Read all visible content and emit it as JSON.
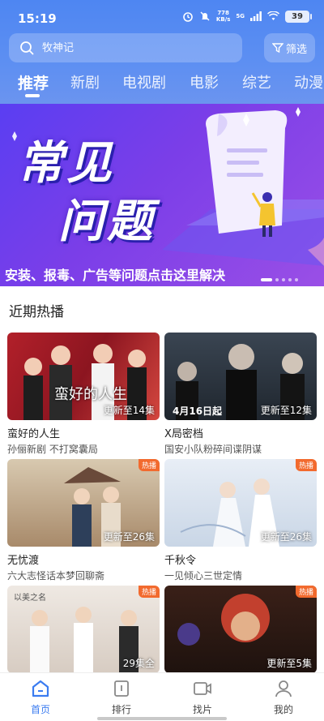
{
  "status_bar": {
    "time": "15:19",
    "net_speed": "778",
    "net_unit": "KB/s",
    "signal": "5G",
    "battery": "39"
  },
  "search": {
    "placeholder": "牧神记",
    "icon": "search-icon"
  },
  "filter": {
    "label": "筛选",
    "icon": "filter-icon"
  },
  "tabs": [
    "推荐",
    "新剧",
    "电视剧",
    "电影",
    "综艺",
    "动漫"
  ],
  "active_tab": "推荐",
  "banner": {
    "line1": "常见",
    "line2": "问题",
    "caption": "安装、报毒、广告等问题点击这里解决"
  },
  "section_title": "近期热播",
  "cards": [
    {
      "title": "蛮好的人生",
      "subtitle": "孙俪新剧 不打窝囊局",
      "episodes": "更新至14集",
      "poster_text": "蛮好的人生"
    },
    {
      "title": "X局密档",
      "subtitle": "国安小队粉碎间谍阴谋",
      "episodes": "更新至12集",
      "poster_text": "4月16日起"
    },
    {
      "title": "无忧渡",
      "subtitle": "六大志怪话本梦回聊斋",
      "episodes": "更新至26集",
      "badge": "热播"
    },
    {
      "title": "千秋令",
      "subtitle": "一见倾心三世定情",
      "episodes": "更新至26集",
      "badge": "热播"
    },
    {
      "title": "以美之名",
      "subtitle": "",
      "episodes": "29集全",
      "badge": "热播"
    },
    {
      "title": "",
      "subtitle": "",
      "episodes": "更新至5集",
      "badge": "热播"
    }
  ],
  "bottom_nav": [
    {
      "label": "首页",
      "icon": "home-icon"
    },
    {
      "label": "排行",
      "icon": "ranking-icon"
    },
    {
      "label": "找片",
      "icon": "video-icon"
    },
    {
      "label": "我的",
      "icon": "profile-icon"
    }
  ],
  "colors": {
    "accent": "#3b7cf0",
    "header": "#5a8ff2",
    "badge": "#f26a2e"
  }
}
